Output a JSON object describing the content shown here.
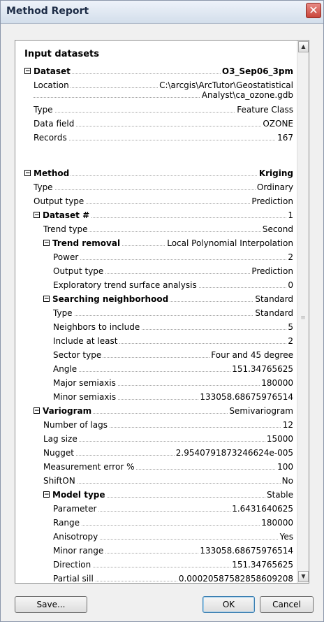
{
  "window": {
    "title": "Method Report",
    "close_glyph": "✕"
  },
  "report": {
    "section_title": "Input datasets",
    "dataset": {
      "label": "Dataset",
      "value": "O3_Sep06_3pm",
      "location_label": "Location",
      "location_line1": "C:\\arcgis\\ArcTutor\\Geostatistical",
      "location_line2": "Analyst\\ca_ozone.gdb",
      "type_label": "Type",
      "type_value": "Feature Class",
      "data_field_label": "Data field",
      "data_field_value": "OZONE",
      "records_label": "Records",
      "records_value": "167"
    },
    "method": {
      "label": "Method",
      "value": "Kriging",
      "type_label": "Type",
      "type_value": "Ordinary",
      "output_type_label": "Output type",
      "output_type_value": "Prediction",
      "dataset_num_label": "Dataset #",
      "dataset_num_value": "1",
      "trend_type_label": "Trend type",
      "trend_type_value": "Second",
      "trend_removal_label": "Trend removal",
      "trend_removal_value": "Local Polynomial Interpolation",
      "power_label": "Power",
      "power_value": "2",
      "tr_output_type_label": "Output type",
      "tr_output_type_value": "Prediction",
      "etsa_label": "Exploratory trend surface analysis",
      "etsa_value": "0",
      "searching_label": "Searching neighborhood",
      "searching_value": "Standard",
      "sn_type_label": "Type",
      "sn_type_value": "Standard",
      "neighbors_label": "Neighbors to include",
      "neighbors_value": "5",
      "at_least_label": "Include at least",
      "at_least_value": "2",
      "sector_label": "Sector type",
      "sector_value": "Four and 45 degree",
      "angle_label": "Angle",
      "angle_value": "151.34765625",
      "major_label": "Major semiaxis",
      "major_value": "180000",
      "minor_label": "Minor semiaxis",
      "minor_value": "133058.68675976514"
    },
    "variogram": {
      "label": "Variogram",
      "value": "Semivariogram",
      "lags_label": "Number of lags",
      "lags_value": "12",
      "lag_size_label": "Lag size",
      "lag_size_value": "15000",
      "nugget_label": "Nugget",
      "nugget_value": "2.9540791873246624e-005",
      "meas_err_label": "Measurement error %",
      "meas_err_value": "100",
      "shifton_label": "ShiftON",
      "shifton_value": "No",
      "model_type_label": "Model type",
      "model_type_value": "Stable",
      "parameter_label": "Parameter",
      "parameter_value": "1.6431640625",
      "range_label": "Range",
      "range_value": "180000",
      "anisotropy_label": "Anisotropy",
      "anisotropy_value": "Yes",
      "minor_range_label": "Minor range",
      "minor_range_value": "133058.68675976514",
      "direction_label": "Direction",
      "direction_value": "151.34765625",
      "partial_sill_label": "Partial sill",
      "partial_sill_value": "0.00020587582858609208"
    },
    "expander_glyph": "−"
  },
  "scrollbar": {
    "up_glyph": "▲",
    "down_glyph": "▼",
    "grip_glyph": "≡"
  },
  "buttons": {
    "save": "Save...",
    "ok": "OK",
    "cancel": "Cancel"
  }
}
